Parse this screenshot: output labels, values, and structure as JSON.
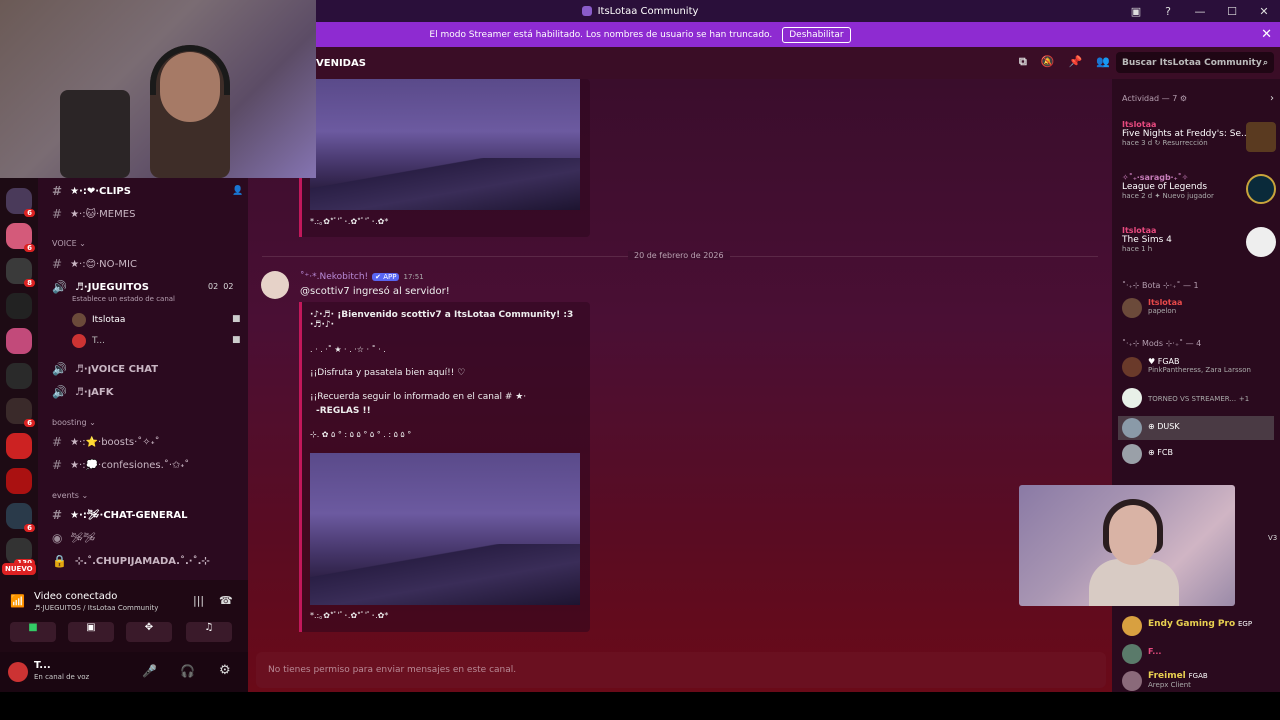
{
  "window": {
    "title": "ItsLotaa Community"
  },
  "banner": {
    "text": "El modo Streamer está habilitado. Los nombres de usuario se han truncado.",
    "button": "Deshabilitar"
  },
  "channel_header": {
    "name": "VENIDAS",
    "search_placeholder": "Buscar ItsLotaa Community"
  },
  "servers": {
    "badges": [
      "6",
      "6",
      "8",
      "",
      "",
      "",
      "",
      "6",
      "",
      "",
      "",
      "6",
      "130"
    ],
    "nuevo": "NUEVO"
  },
  "channels": {
    "clips": "★·:❤·CLIPS",
    "memes": "★·:🐱·MEMES",
    "voice_category": "VOICE",
    "nomic": "★·:😊·NO-MIC",
    "jueguitos": "♬·JUEGUITOS",
    "jueguitos_status": "Establece un estado de canal",
    "jueguitos_count_a": "02",
    "jueguitos_count_b": "02",
    "vc_user1": "Itslotaa",
    "vc_user2": "T...",
    "voice_chat": "♬·ꞁVOICE CHAT",
    "afk": "♬·ꞁAFK",
    "boosting_category": "boosting",
    "boosts": "★·:⭐·boosts·˚✧˖˚",
    "confesiones": "★·:💭·confesiones.˚·✩˖˚",
    "events_category": "events",
    "chat_general": "★·:🛩·CHAT-GENERAL",
    "stage": "🛩🛩",
    "chupijamada": "⊹.˚.CHUPIJAMADA.˚.·˚.⊹"
  },
  "voice_panel": {
    "status": "Video conectado",
    "channel": "♬·JUEGUITOS / ItsLotaa Community"
  },
  "user_panel": {
    "name": "T...",
    "status": "En canal de voz"
  },
  "messages": {
    "caption1": "*.:｡✿*ﾟ'ﾟ･.✿*ﾟ'ﾟ･.✿*",
    "date": "20 de febrero de 2026",
    "author": "˚⁺‧*.Nekobitch!",
    "app_tag": "✔ APP",
    "time": "17:51",
    "join": "@scottiv7 ingresó al servidor!",
    "welcome": "·♪·♬· ¡Bienvenido scottiv7 a ItsLotaa Community! :3 ·♬·♪·",
    "stars": ". ·  . ·˚  ★ · . ·☆ · ˚  · .",
    "line1": "¡¡Disfruta y pasatela bien aquí!! ♡",
    "line2": "¡¡Recuerda seguir lo informado en el canal # ★·",
    "line2b": "-REGLAS !!",
    "deco": "⊹. ✿ ۵ ° : ۵ ۵ ° ۵ ° . : ۵ ۵ °",
    "caption2": "*.:｡✿*ﾟ'ﾟ･.✿*ﾟ'ﾟ･.✿*",
    "composer": "No tienes permiso para enviar mensajes en este canal."
  },
  "members": {
    "activity_header": "Actividad — 7 ⚙",
    "act1_user": "Itslotaa",
    "act1_game": "Five Nights at Freddy's: Se...",
    "act1_sub": "hace 3 d  ↻ Resurrección",
    "act2_user": "✧˚₊‧saragb‧₊˚✧",
    "act2_game": "League of Legends",
    "act2_sub": "hace 2 d  ✦ Nuevo jugador",
    "act3_user": "Itslotaa",
    "act3_game": "The Sims 4",
    "act3_sub": "hace 1 h",
    "group1": "˚‧₊⊹ Bota ⊹‧₊˚ — 1",
    "g1_user": "Itslotaa",
    "g1_sub": "papelon",
    "group2": "˚‧₊⊹ Mods ⊹‧₊˚ — 4",
    "m1_tag": "FGAB",
    "m1_sub": "PinkPantheress, Zara Larsson",
    "m2_sub": "TORNEO VS STREAMER...",
    "m2_extra": "+1",
    "m3_tag": "DUSK",
    "m4_tag": "FCB",
    "m5_name": "Endy Gaming Pro",
    "m5_tag": "EGP",
    "m6_name": "F...",
    "m7_name": "Freimel",
    "m7_tag": "FGAB",
    "m7_sub": "Arepx Client",
    "v3": "V3"
  },
  "colors": {
    "accent": "#8e2bd1",
    "mention_bar": "#c2185b",
    "member_name": "#e84a7f"
  }
}
